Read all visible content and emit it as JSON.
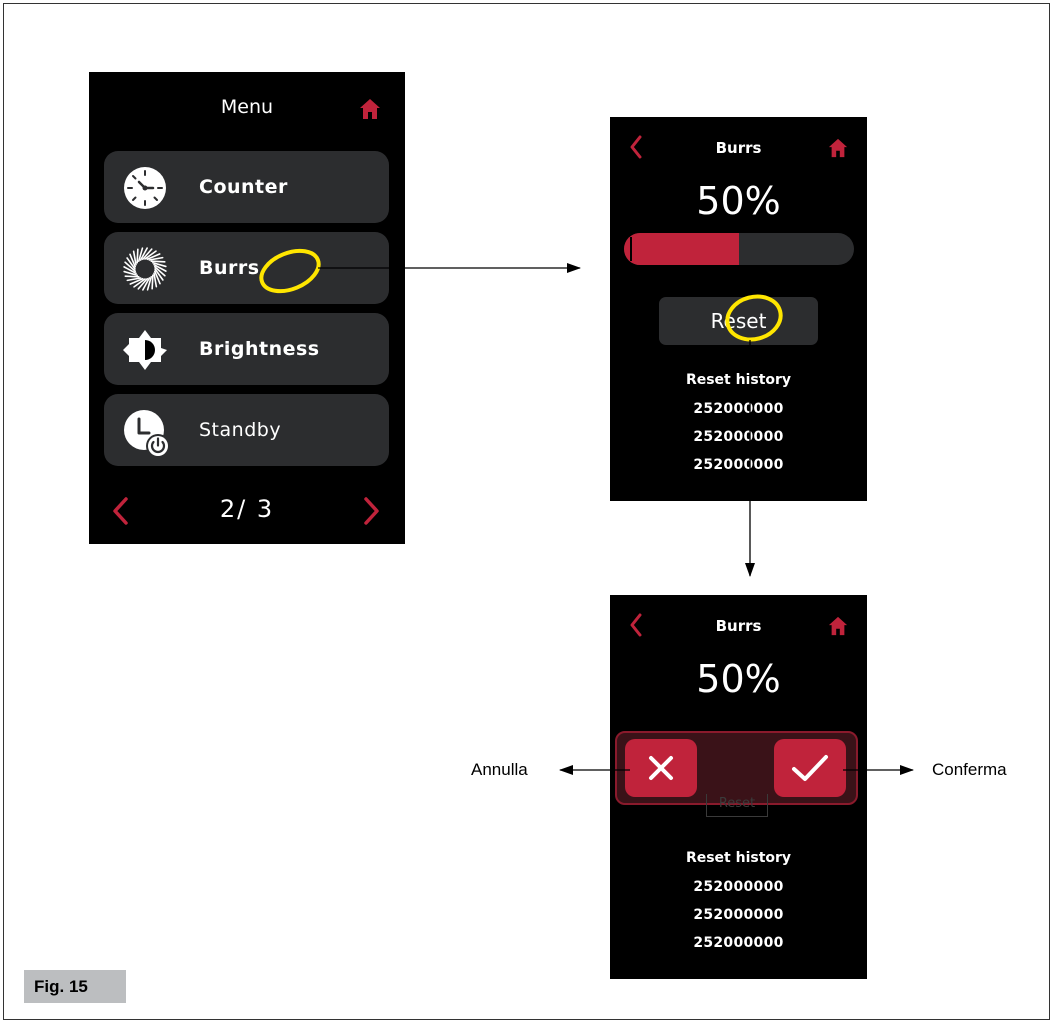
{
  "colors": {
    "accent": "#c0233b",
    "screen_bg": "#000000",
    "tile_bg": "#2c2d2f",
    "highlight": "#ffe600"
  },
  "menu_screen": {
    "title": "Menu",
    "home_icon": "home-icon",
    "items": [
      {
        "label": "Counter",
        "icon": "counter-dial-icon"
      },
      {
        "label": "Burrs",
        "icon": "burrs-icon"
      },
      {
        "label": "Brightness",
        "icon": "brightness-icon"
      },
      {
        "label": "Standby",
        "icon": "standby-clock-icon"
      }
    ],
    "page_indicator": "2/ 3",
    "prev_icon": "chevron-left-icon",
    "next_icon": "chevron-right-icon"
  },
  "burrs_screen": {
    "title": "Burrs",
    "percent_label": "50%",
    "progress_fraction": 0.5,
    "reset_label": "Reset",
    "history_heading": "Reset history",
    "history": [
      "252000000",
      "252000000",
      "252000000"
    ]
  },
  "burrs_confirm_screen": {
    "title": "Burrs",
    "percent_label": "50%",
    "ghost_reset_label": "Reset",
    "cancel_icon": "close-icon",
    "confirm_icon": "check-icon",
    "history_heading": "Reset history",
    "history": [
      "252000000",
      "252000000",
      "252000000"
    ]
  },
  "annotations": {
    "cancel_label": "Annulla",
    "confirm_label": "Conferma"
  },
  "figure_label": "Fig. 15"
}
